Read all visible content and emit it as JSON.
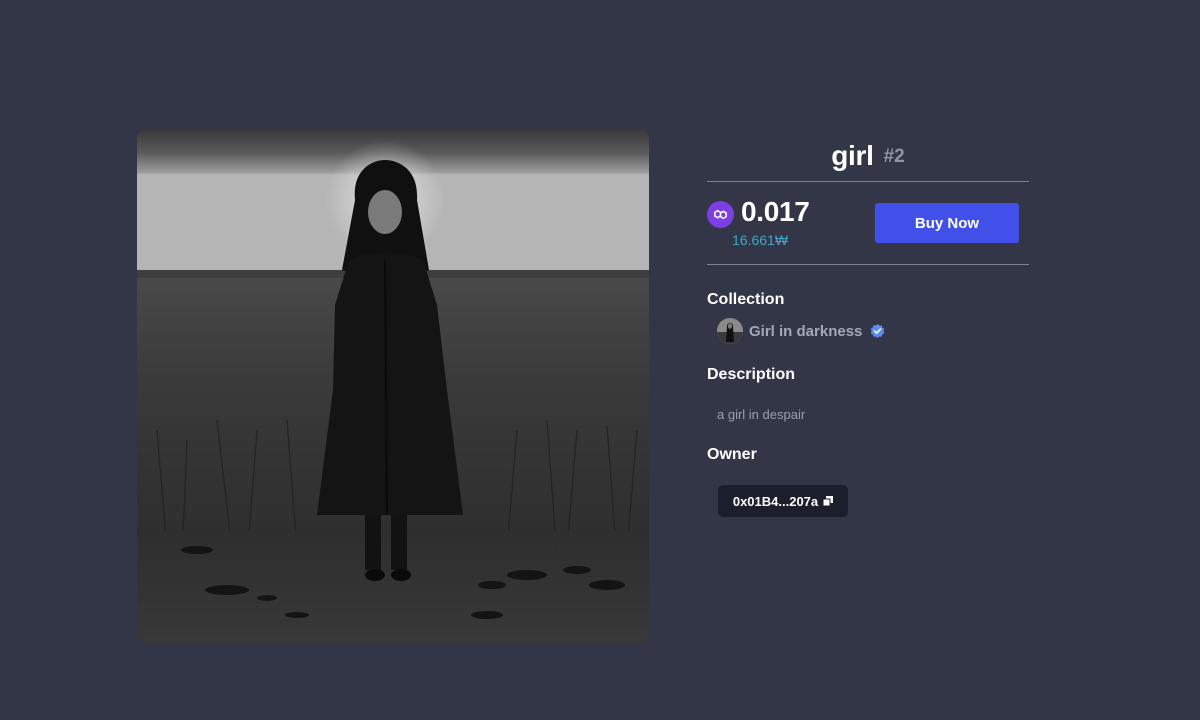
{
  "nft": {
    "name": "girl",
    "token_id": "#2",
    "artwork_alt": "girl",
    "chain_icon": "polygon-icon"
  },
  "price": {
    "amount": "0.017",
    "fiat": "16.661₩"
  },
  "actions": {
    "buy_label": "Buy Now"
  },
  "collection": {
    "heading": "Collection",
    "name": "Girl in darkness",
    "verified": true
  },
  "description": {
    "heading": "Description",
    "text": "a girl in despair"
  },
  "owner": {
    "heading": "Owner",
    "address": "0x01B4...207a"
  },
  "colors": {
    "background": "#323647",
    "accent_button": "#4150e8",
    "fiat_text": "#3fa6c9",
    "chain_purple": "#7b3fe4",
    "verified_blue": "#5b8def"
  }
}
